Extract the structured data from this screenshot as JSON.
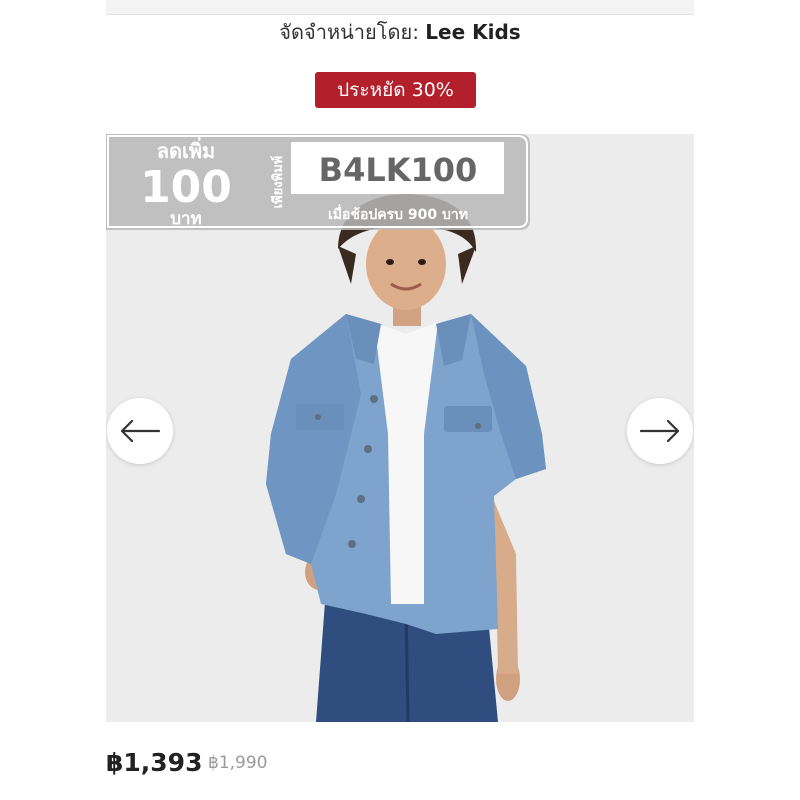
{
  "seller": {
    "prefix": "จัดจำหน่ายโดย:",
    "name": "Lee Kids"
  },
  "badge": {
    "label": "ประหยัด 30%",
    "color": "#b3202b"
  },
  "promo": {
    "title": "ลดเพิ่ม",
    "amount": "100",
    "unit": "บาท",
    "vertical_text": "เพียงพิมพ์",
    "code": "B4LK100",
    "condition": "เมื่อช้อปครบ 900 บาท"
  },
  "gallery": {
    "prev_icon": "arrow-left-icon",
    "next_icon": "arrow-right-icon",
    "image": "boy-in-denim-jacket"
  },
  "price": {
    "current": "฿1,393",
    "original": "฿1,990"
  }
}
